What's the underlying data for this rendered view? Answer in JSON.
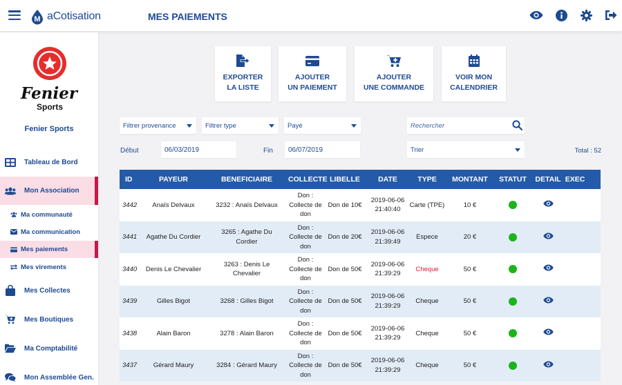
{
  "app": {
    "logo_text": "aCotisation",
    "page_title": "MES PAIEMENTS"
  },
  "brand": {
    "logo_line1": "Fenier",
    "logo_line2": "Sports",
    "name": "Fenier Sports"
  },
  "nav": {
    "tableau": "Tableau de Bord",
    "association": "Mon Association",
    "communaute": "Ma communauté",
    "communication": "Ma communication",
    "paiements": "Mes paiements",
    "virements": "Mes virements",
    "collectes": "Mes Collectes",
    "boutiques": "Mes Boutiques",
    "comptabilite": "Ma Comptabilité",
    "assemblee": "Mon Assemblée Gen."
  },
  "actions": {
    "export": "EXPORTER\nLA LISTE",
    "add_payment": "AJOUTER\nUN PAIEMENT",
    "add_order": "AJOUTER\nUNE COMMANDE",
    "calendar": "VOIR MON\nCALENDRIER"
  },
  "filters": {
    "provenance": "Filtrer provenance",
    "type": "Filtrer type",
    "status": "Payé",
    "search_placeholder": "Rechercher",
    "debut_label": "Début",
    "debut_value": "06/03/2019",
    "fin_label": "Fin",
    "fin_value": "06/07/2019",
    "sort": "Trier",
    "total": "Total : 52"
  },
  "table": {
    "headers": {
      "id": "ID",
      "payeur": "PAYEUR",
      "beneficiaire": "BENEFICIAIRE",
      "collecte": "COLLECTE",
      "libelle": "LIBELLE",
      "date": "DATE",
      "type": "TYPE",
      "montant": "MONTANT",
      "statut": "STATUT",
      "detail": "DETAIL",
      "exec": "EXEC"
    },
    "rows": [
      {
        "id": "3442",
        "payeur": "Anaïs  Delvaux",
        "beneficiaire": "3232 : Anaïs  Delvaux",
        "collecte": "Don :\nCollecte de\ndon",
        "libelle": "Don de 10€",
        "date": "2019-06-06\n21:40:40",
        "type": "Carte (TPE)",
        "montant": "10 €"
      },
      {
        "id": "3441",
        "payeur": "Agathe  Du Cordier",
        "beneficiaire": "3265 : Agathe  Du\nCordier",
        "collecte": "Don :\nCollecte de\ndon",
        "libelle": "Don de 20€",
        "date": "2019-06-06\n21:39:49",
        "type": "Espece",
        "montant": "20 €"
      },
      {
        "id": "3440",
        "payeur": "Denis  Le Chevalier",
        "beneficiaire": "3263 : Denis  Le\nChevalier",
        "collecte": "Don :\nCollecte de\ndon",
        "libelle": "Don de 50€",
        "date": "2019-06-06\n21:39:29",
        "type": "Cheque",
        "montant": "50 €"
      },
      {
        "id": "3439",
        "payeur": "Gilles  Bigot",
        "beneficiaire": "3268 : Gilles  Bigot",
        "collecte": "Don :\nCollecte de\ndon",
        "libelle": "Don de 50€",
        "date": "2019-06-06\n21:39:29",
        "type": "Cheque",
        "montant": "50 €"
      },
      {
        "id": "3438",
        "payeur": "Alain  Baron",
        "beneficiaire": "3278 : Alain  Baron",
        "collecte": "Don :\nCollecte de\ndon",
        "libelle": "Don de 50€",
        "date": "2019-06-06\n21:39:29",
        "type": "Cheque",
        "montant": "50 €"
      },
      {
        "id": "3437",
        "payeur": "Gérard  Maury",
        "beneficiaire": "3284 : Gérard  Maury",
        "collecte": "Don :\nCollecte de\ndon",
        "libelle": "Don de 50€",
        "date": "2019-06-06\n21:39:29",
        "type": "Cheque",
        "montant": "50 €"
      }
    ]
  },
  "colors": {
    "primary": "#1e4a92",
    "table_header": "#245ba8",
    "active_bg": "#fadde5",
    "active_bar": "#c8174a",
    "status_ok": "#1bb51b",
    "cheque_highlight": "#d41933"
  }
}
